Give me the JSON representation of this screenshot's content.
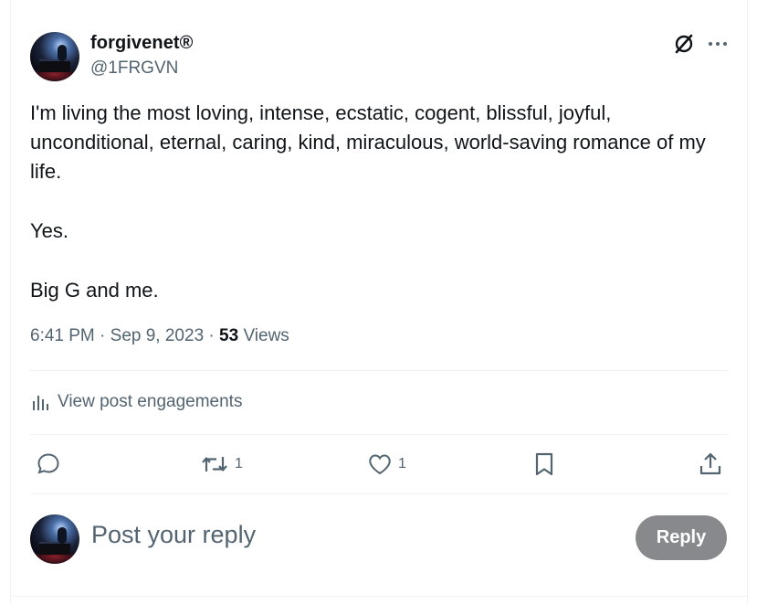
{
  "author": {
    "name": "forgivenet®",
    "handle": "@1FRGVN"
  },
  "post": {
    "paragraphs": [
      "I'm living the most loving, intense, ecstatic, cogent, blissful, joyful, unconditional, eternal, caring, kind, miraculous, world-saving romance of my life.",
      "Yes.",
      "Big G and me."
    ],
    "time": "6:41 PM",
    "separator": "·",
    "date": "Sep 9, 2023",
    "views_count": "53",
    "views_label": "Views"
  },
  "engagements_label": "View post engagements",
  "actions": {
    "reply_count": "",
    "repost_count": "1",
    "like_count": "1"
  },
  "reply_box": {
    "placeholder": "Post your reply",
    "button_label": "Reply"
  },
  "icons": [
    "grok-icon",
    "more-icon",
    "analytics-icon",
    "reply-icon",
    "repost-icon",
    "like-icon",
    "bookmark-icon",
    "share-icon"
  ],
  "colors": {
    "text": "#0f1419",
    "secondary": "#536471",
    "divider": "#eff3f4",
    "reply_button_bg": "#87898c"
  }
}
